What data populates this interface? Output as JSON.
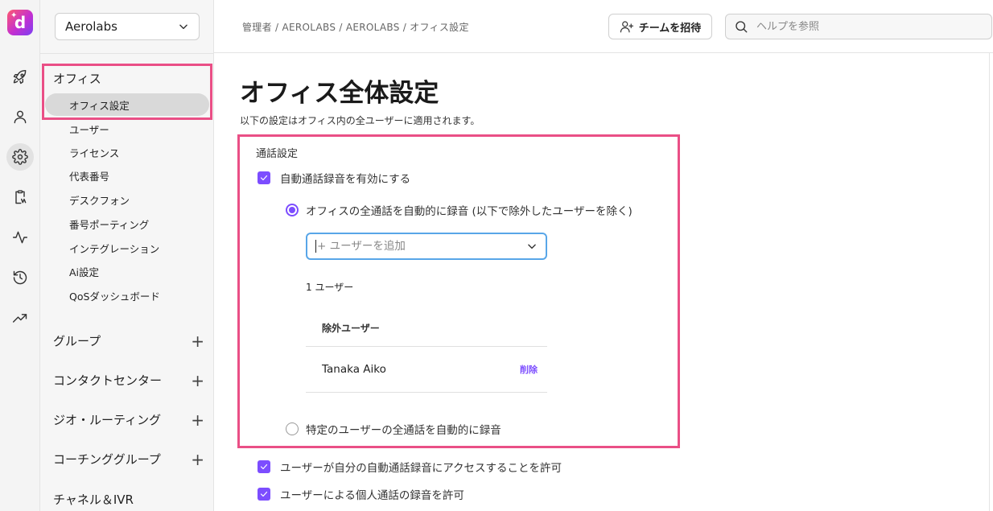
{
  "app": {
    "logo_letter": "d",
    "logo_spark": "✦"
  },
  "rail": {
    "icons": [
      {
        "name": "rocket-icon"
      },
      {
        "name": "person-icon"
      },
      {
        "name": "gear-icon",
        "active": true
      },
      {
        "name": "clipboard-icon"
      },
      {
        "name": "activity-icon"
      },
      {
        "name": "history-icon"
      },
      {
        "name": "trending-icon"
      }
    ]
  },
  "sidebar": {
    "org_name": "Aerolabs",
    "office_section": "オフィス",
    "office_items": [
      "オフィス設定",
      "ユーザー",
      "ライセンス",
      "代表番号",
      "デスクフォン",
      "番号ポーティング",
      "インテグレーション",
      "Ai設定",
      "QoSダッシュボード"
    ],
    "active_item": "オフィス設定",
    "sections": [
      {
        "label": "グループ",
        "plus": "+"
      },
      {
        "label": "コンタクトセンター",
        "plus": "+"
      },
      {
        "label": "ジオ・ルーティング",
        "plus": "+"
      },
      {
        "label": "コーチンググループ",
        "plus": "+"
      },
      {
        "label": "チャネル＆IVR"
      }
    ]
  },
  "header": {
    "breadcrumb": "管理者 / AEROLABS / AEROLABS / オフィス設定",
    "invite_label": "チームを招待",
    "search_placeholder": "ヘルプを参照"
  },
  "main": {
    "title": "オフィス全体設定",
    "description": "以下の設定はオフィス内の全ユーザーに適用されます。",
    "call_settings": {
      "label": "通話設定",
      "auto_record_label": "自動通話録音を有効にする",
      "auto_record_checked": true,
      "radio_all_label": "オフィスの全通話を自動的に録音 (以下で除外したユーザーを除く)",
      "radio_all_selected": true,
      "add_user_placeholder": "+ ユーザーを追加",
      "user_count": "1 ユーザー",
      "excluded_header": "除外ユーザー",
      "excluded_users": [
        {
          "name": "Tanaka Aiko",
          "action": "削除"
        }
      ],
      "radio_specific_label": "特定のユーザーの全通話を自動的に録音",
      "radio_specific_selected": false
    },
    "allow_access_label": "ユーザーが自分の自動通話録音にアクセスすることを許可",
    "allow_access_checked": true,
    "allow_personal_label": "ユーザーによる個人通話の録音を許可",
    "allow_personal_checked": true
  },
  "colors": {
    "accent": "#7c4dff",
    "highlight": "#ea4f86",
    "focus": "#58a6e8"
  }
}
